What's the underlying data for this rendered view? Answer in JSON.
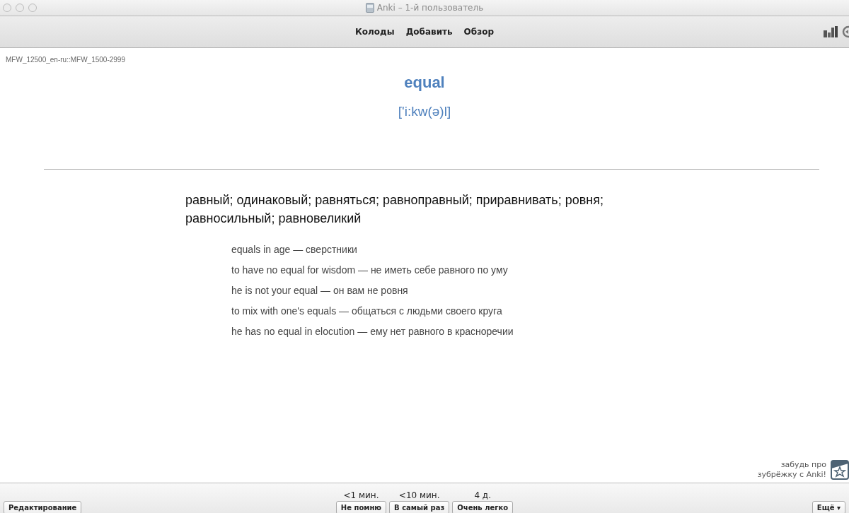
{
  "window": {
    "title": "Anki – 1-й пользователь"
  },
  "toolbar": {
    "links": [
      "Колоды",
      "Добавить",
      "Обзор"
    ]
  },
  "deck_path": "MFW_12500_en-ru::MFW_1500-2999",
  "card": {
    "word": "equal",
    "transcription": "['i:kw(ə)l]",
    "meaning": "равный; одинаковый; равняться; равноправный; приравнивать; ровня; равносильный; равновеликий",
    "examples": [
      "equals in age — сверстники",
      "to have no equal for wisdom — не иметь себе равного по уму",
      "he is not your equal — он вам не ровня",
      "to mix with one's equals — общаться с людьми своего круга",
      "he has no equal in elocution — ему нет равного в красноречии"
    ]
  },
  "promo": {
    "lines": [
      "забудь про",
      "зубрёжку с Anki!"
    ]
  },
  "bottom_bar": {
    "edit_button": "Редактирование",
    "answers": [
      {
        "interval": "<1 мин.",
        "label": "Не помню"
      },
      {
        "interval": "<10 мин.",
        "label": "В самый раз"
      },
      {
        "interval": "4 д.",
        "label": "Очень легко"
      }
    ],
    "more_button": "Ещё ▾"
  }
}
